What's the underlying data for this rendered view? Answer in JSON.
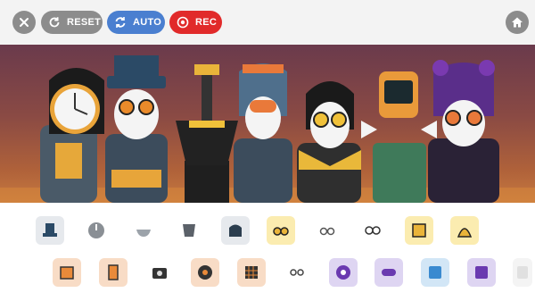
{
  "toolbar": {
    "close_icon": "close-icon",
    "reset_label": "RESET",
    "auto_label": "AUTO",
    "rec_label": "REC",
    "home_icon": "home-icon",
    "colors": {
      "bar": "#f3f3f3",
      "grey": "#8c8c8c",
      "auto": "#4a7fd0",
      "rec": "#e12a2a"
    }
  },
  "stage": {
    "characters": [
      "clock-head",
      "top-hat",
      "lamp",
      "helmet-visor",
      "glasses-scarf",
      "robot",
      "purple-horns"
    ]
  },
  "tray": {
    "row1": [
      {
        "icon": "top-hat-icon",
        "bg": "#e6e9ed"
      },
      {
        "icon": "clock-disc-icon",
        "bg": "#ffffff"
      },
      {
        "icon": "bowl-icon",
        "bg": "#ffffff"
      },
      {
        "icon": "bucket-icon",
        "bg": "#ffffff"
      },
      {
        "icon": "helmet-icon",
        "bg": "#e6e9ed"
      },
      {
        "icon": "spectacles-icon",
        "bg": "#fbecb0"
      },
      {
        "icon": "glasses-icon",
        "bg": "#ffffff"
      },
      {
        "icon": "round-glasses-icon",
        "bg": "#ffffff"
      },
      {
        "icon": "yellow-box-icon",
        "bg": "#fbecb0"
      },
      {
        "icon": "stripe-bell-icon",
        "bg": "#fbecb0"
      }
    ],
    "row2": [
      {
        "icon": "orange-block-icon",
        "bg": "#f8dcc6"
      },
      {
        "icon": "orange-robot-icon",
        "bg": "#f8dcc6"
      },
      {
        "icon": "camera-icon",
        "bg": "#ffffff"
      },
      {
        "icon": "orange-ball-icon",
        "bg": "#f8dcc6"
      },
      {
        "icon": "orange-grid-icon",
        "bg": "#f8dcc6"
      },
      {
        "icon": "small-glasses-icon",
        "bg": "#ffffff"
      },
      {
        "icon": "purple-eye-icon",
        "bg": "#ded5f2"
      },
      {
        "icon": "purple-pill-icon",
        "bg": "#ded5f2"
      },
      {
        "icon": "blue-chip-icon",
        "bg": "#d2e6f6"
      },
      {
        "icon": "purple-chip-icon",
        "bg": "#ded5f2"
      },
      {
        "icon": "faded-slot-icon",
        "bg": "#f4f4f4"
      }
    ]
  }
}
